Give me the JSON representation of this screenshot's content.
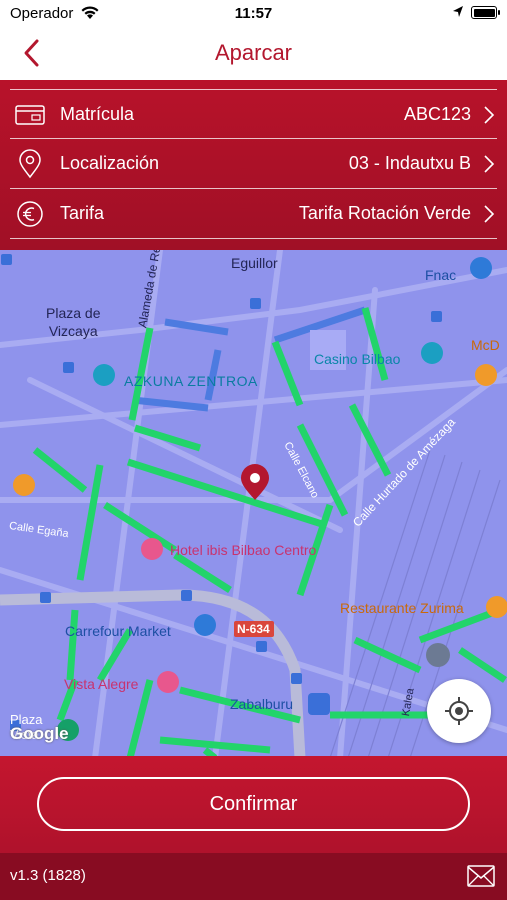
{
  "status_bar": {
    "carrier": "Operador",
    "time": "11:57"
  },
  "nav": {
    "title": "Aparcar"
  },
  "form": {
    "rows": [
      {
        "label": "Matrícula",
        "value": "ABC123",
        "icon": "card-icon"
      },
      {
        "label": "Localización",
        "value": "03 - Indautxu B",
        "icon": "location-pin-icon"
      },
      {
        "label": "Tarifa",
        "value": "Tarifa Rotación Verde",
        "icon": "euro-icon"
      }
    ]
  },
  "map": {
    "labels": {
      "eguillor": "Eguillor",
      "fnac": "Fnac",
      "plaza_vizcaya": "Plaza de\nVizcaya",
      "alameda": "Alameda de Re",
      "casino": "Casino Bilbao",
      "mcd": "McD",
      "azkuna": "AZKUNA ZENTROA",
      "elcano": "Calle Elcano",
      "hurtado": "Calle Hurtado de Amézaga",
      "egana": "Calle Egaña",
      "ibis": "Hotel ibis Bilbao Centro",
      "zurima": "Restaurante Zurima",
      "carrefour": "Carrefour Market",
      "n634": "N-634",
      "vista_alegre": "Vista Alegre",
      "zabalburu": "Zabalburu",
      "plaza_vista": "Plaza\nVista",
      "kalea": "Kalea",
      "google": "Google"
    },
    "colors": {
      "background": "#8f93ec",
      "green_zone": "#22d46a",
      "blue_zone": "#4d7be0",
      "pin": "#b3172e"
    }
  },
  "actions": {
    "confirm_label": "Confirmar"
  },
  "footer": {
    "version": "v1.3 (1828)"
  }
}
